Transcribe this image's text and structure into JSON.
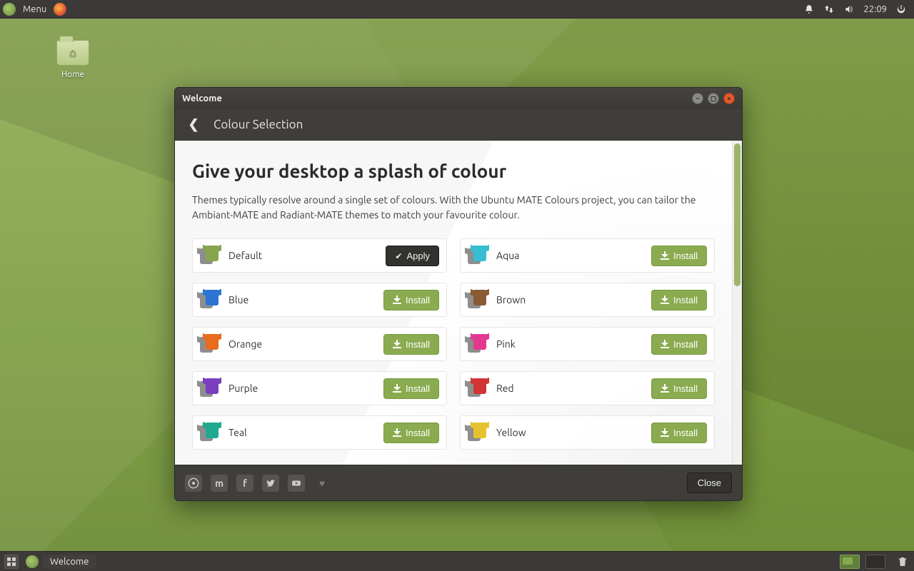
{
  "top_panel": {
    "menu_label": "Menu",
    "clock": "22:09"
  },
  "desktop": {
    "home_label": "Home"
  },
  "bottom_panel": {
    "task_label": "Welcome"
  },
  "window": {
    "title": "Welcome",
    "header": "Colour Selection",
    "main": {
      "heading": "Give your desktop a splash of colour",
      "description": "Themes typically resolve around a single set of colours. With the Ubuntu MATE Colours project, you can tailor the Ambiant-MATE and Radiant-MATE themes to match your favourite colour."
    },
    "buttons": {
      "apply": "Apply",
      "install": "Install",
      "close": "Close"
    },
    "themes": [
      {
        "name": "Default",
        "action": "apply",
        "color_class": "c-default"
      },
      {
        "name": "Aqua",
        "action": "install",
        "color_class": "c-aqua"
      },
      {
        "name": "Blue",
        "action": "install",
        "color_class": "c-blue"
      },
      {
        "name": "Brown",
        "action": "install",
        "color_class": "c-brown"
      },
      {
        "name": "Orange",
        "action": "install",
        "color_class": "c-orange"
      },
      {
        "name": "Pink",
        "action": "install",
        "color_class": "c-pink"
      },
      {
        "name": "Purple",
        "action": "install",
        "color_class": "c-purple"
      },
      {
        "name": "Red",
        "action": "install",
        "color_class": "c-red"
      },
      {
        "name": "Teal",
        "action": "install",
        "color_class": "c-teal"
      },
      {
        "name": "Yellow",
        "action": "install",
        "color_class": "c-yellow"
      }
    ]
  }
}
